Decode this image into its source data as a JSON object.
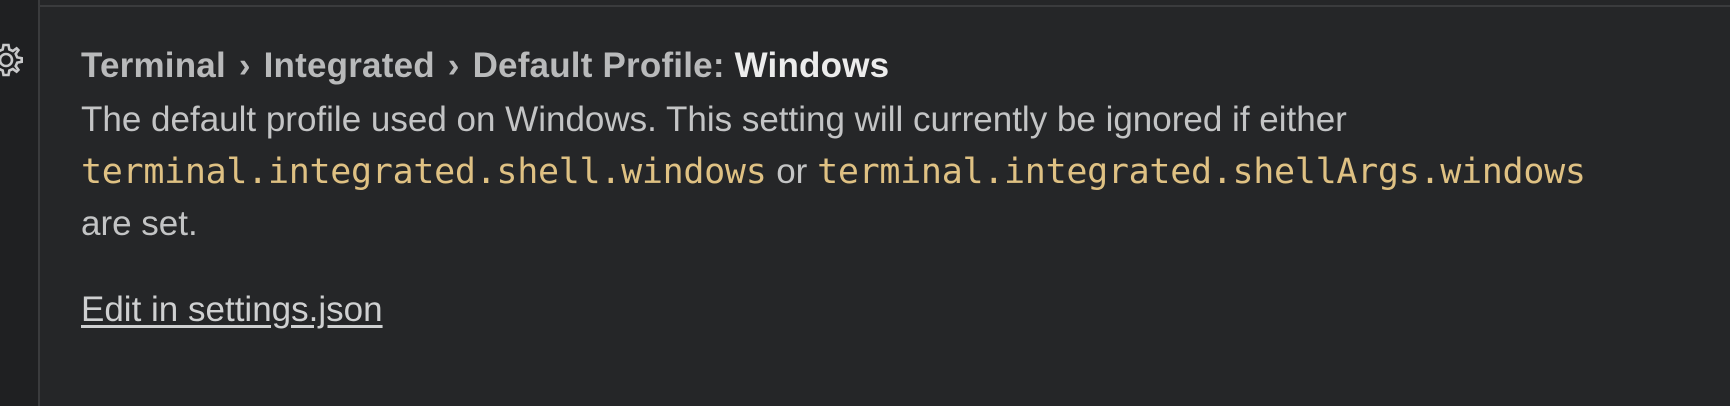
{
  "setting": {
    "breadcrumb": [
      "Terminal",
      "Integrated",
      "Default Profile:"
    ],
    "separator": "›",
    "name": "Windows",
    "description": {
      "part1": "The default profile used on Windows. This setting will currently be ignored if either",
      "code1": "terminal.integrated.shell.windows",
      "part2": "or",
      "code2": "terminal.integrated.shellArgs.windows",
      "part3": "are set."
    },
    "edit_link": "Edit in settings.json"
  },
  "icons": {
    "gear": "gear-icon"
  },
  "colors": {
    "background": "#252628",
    "code": "#dfc183",
    "title_strong": "#ececec"
  }
}
